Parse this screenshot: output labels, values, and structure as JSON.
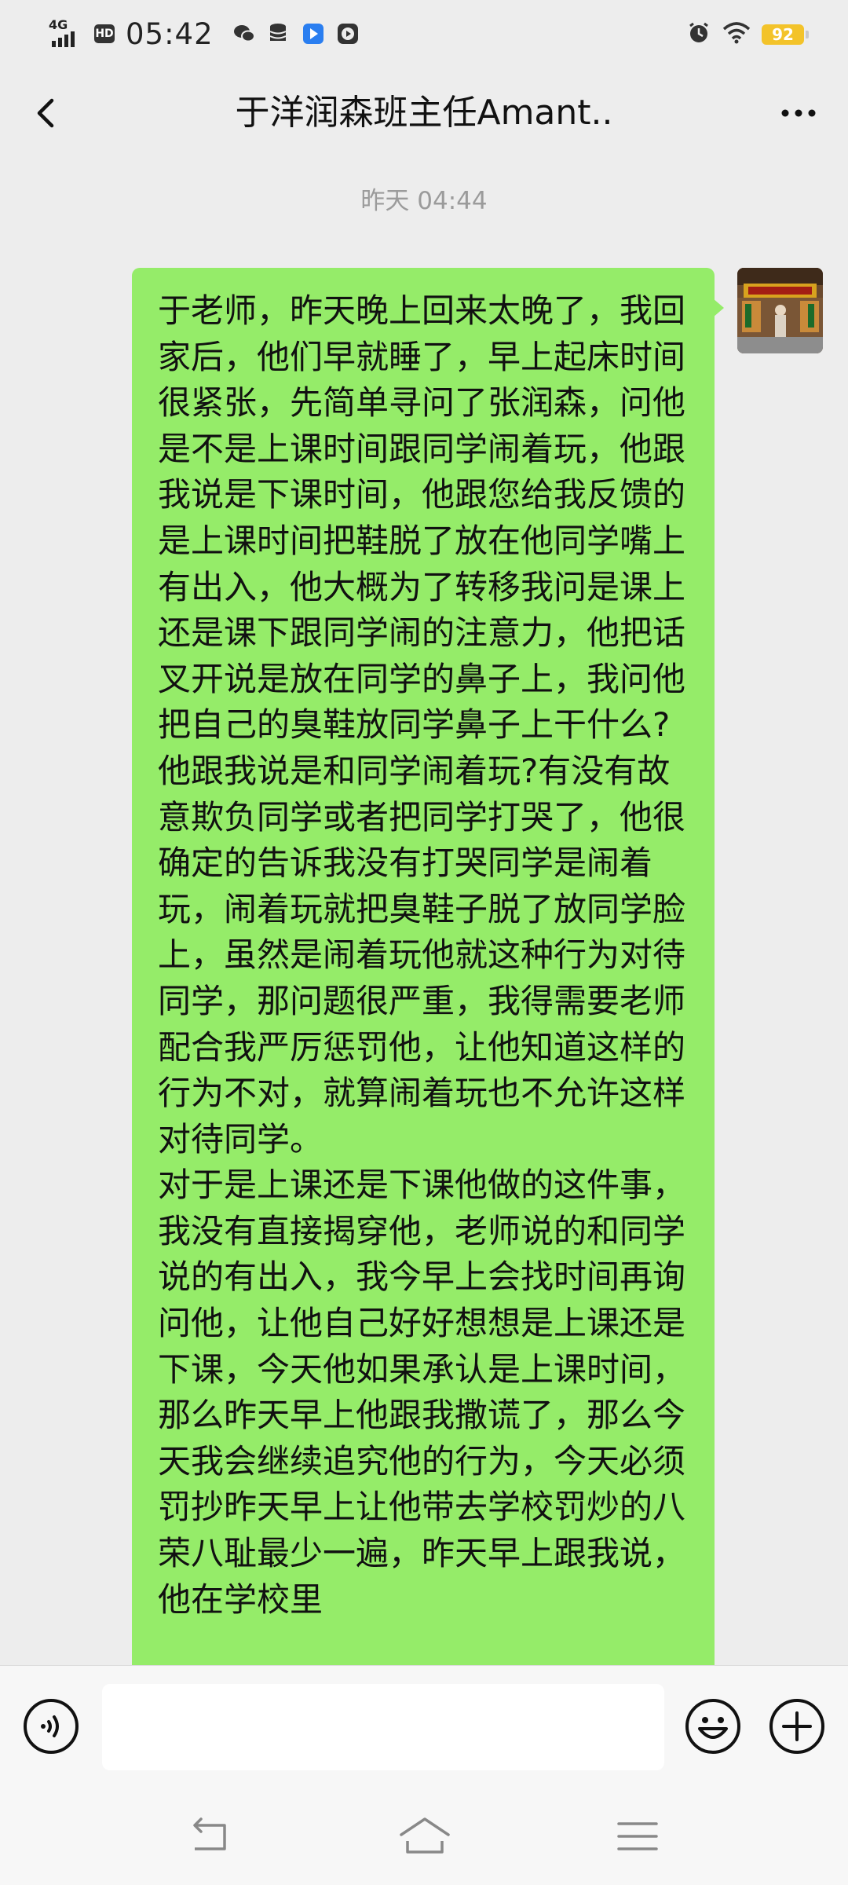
{
  "status_bar": {
    "network": "4G",
    "hd": "HD",
    "time": "05:42",
    "battery": "92",
    "icons": [
      "wechat-icon",
      "storage-icon",
      "app-blue-icon",
      "play-icon",
      "alarm-icon",
      "wifi-icon"
    ]
  },
  "header": {
    "title": "于洋润森班主任Amant..",
    "back_icon": "back-chevron-icon",
    "more_icon": "more-dots-icon"
  },
  "chat": {
    "timestamp": "昨天 04:44",
    "message": "于老师，昨天晚上回来太晚了，我回家后，他们早就睡了，早上起床时间很紧张，先简单寻问了张润森，问他是不是上课时间跟同学闹着玩，他跟我说是下课时间，他跟您给我反馈的是上课时间把鞋脱了放在他同学嘴上有出入，他大概为了转移我问是课上还是课下跟同学闹的注意力，他把话叉开说是放在同学的鼻子上，我问他把自己的臭鞋放同学鼻子上干什么?他跟我说是和同学闹着玩?有没有故意欺负同学或者把同学打哭了，他很确定的告诉我没有打哭同学是闹着玩，闹着玩就把臭鞋子脱了放同学脸上，虽然是闹着玩他就这种行为对待同学，那问题很严重，我得需要老师配合我严厉惩罚他，让他知道这样的行为不对，就算闹着玩也不允许这样对待同学。\n对于是上课还是下课他做的这件事，我没有直接揭穿他，老师说的和同学说的有出入，我今早上会找时间再询问他，让他自己好好想想是上课还是下课，今天他如果承认是上课时间，那么昨天早上他跟我撒谎了，那么今天我会继续追究他的行为，今天必须罚抄昨天早上让他带去学校罚炒的八荣八耻最少一遍，昨天早上跟我说，他在学校里"
  },
  "input_bar": {
    "voice_icon": "voice-icon",
    "text_value": "",
    "emoji_icon": "emoji-icon",
    "plus_icon": "plus-icon"
  },
  "system_nav": {
    "back_icon": "sys-back-icon",
    "home_icon": "sys-home-icon",
    "menu_icon": "sys-menu-icon"
  },
  "colors": {
    "background": "#ededed",
    "bubble": "#95ec69",
    "bar": "#f7f7f7",
    "battery": "#f3c32a"
  }
}
